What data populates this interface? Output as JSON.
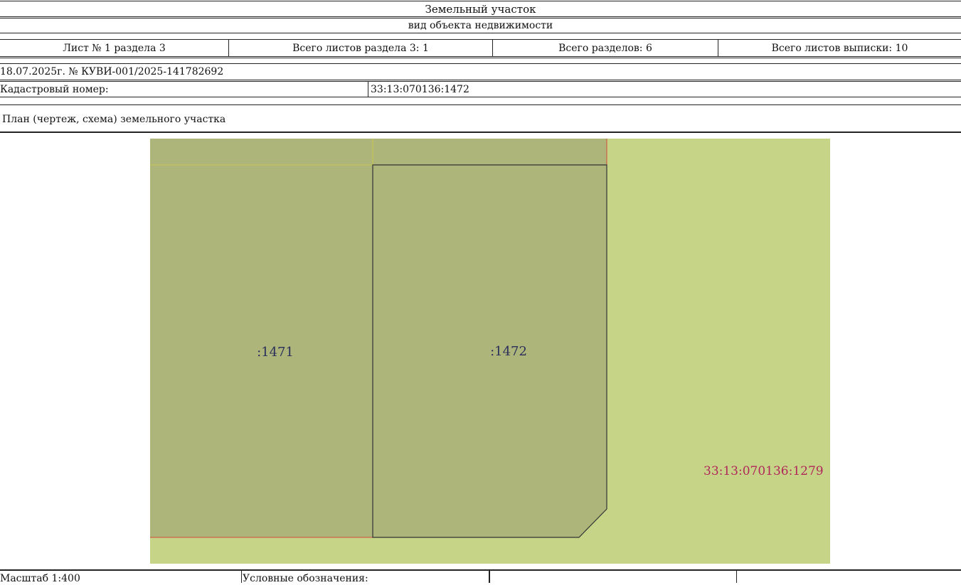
{
  "header": {
    "object_type": "Земельный участок",
    "object_type_caption": "вид объекта недвижимости",
    "sheet_no": "Лист № 1 раздела 3",
    "section_sheets": "Всего листов раздела 3: 1",
    "sections_total": "Всего разделов: 6",
    "extract_sheets": "Всего листов выписки: 10"
  },
  "document": {
    "date_number": "18.07.2025г. № КУВИ-001/2025-141782692",
    "cadastral_label": "Кадастровый номер:",
    "cadastral_value": "33:13:070136:1472"
  },
  "plan": {
    "title": "План (чертеж, схема) земельного участка",
    "parcels": [
      {
        "label": ":1471"
      },
      {
        "label": ":1472"
      }
    ],
    "neighbor_label": "33:13:070136:1279",
    "colors": {
      "background": "#c6d487",
      "parcel_fill": "#adb57b",
      "boundary": "#333333",
      "neighbor_boundary": "#d04a3a",
      "neighbor_text": "#b0285a",
      "parcel_text": "#2a2f5a"
    }
  },
  "footer": {
    "scale": "Масштаб 1:400",
    "legend": "Условные обозначения:"
  }
}
